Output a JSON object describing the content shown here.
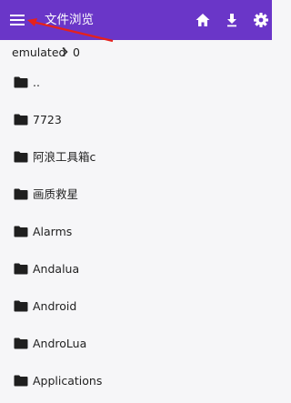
{
  "appbar": {
    "title": "文件浏览",
    "bg_color": "#6a36c8",
    "icons": [
      "menu-icon",
      "home-icon",
      "download-icon",
      "gear-icon"
    ]
  },
  "breadcrumb": {
    "segments": [
      "emulated",
      "0"
    ],
    "separator_icon": "chevron-right-icon"
  },
  "files": [
    {
      "name": ".."
    },
    {
      "name": "7723"
    },
    {
      "name": "阿浪工具箱c"
    },
    {
      "name": "画质救星"
    },
    {
      "name": "Alarms"
    },
    {
      "name": "Andalua"
    },
    {
      "name": "Android"
    },
    {
      "name": "AndroLua"
    },
    {
      "name": "Applications"
    }
  ],
  "annotation": {
    "arrow_color": "#e5211c"
  }
}
